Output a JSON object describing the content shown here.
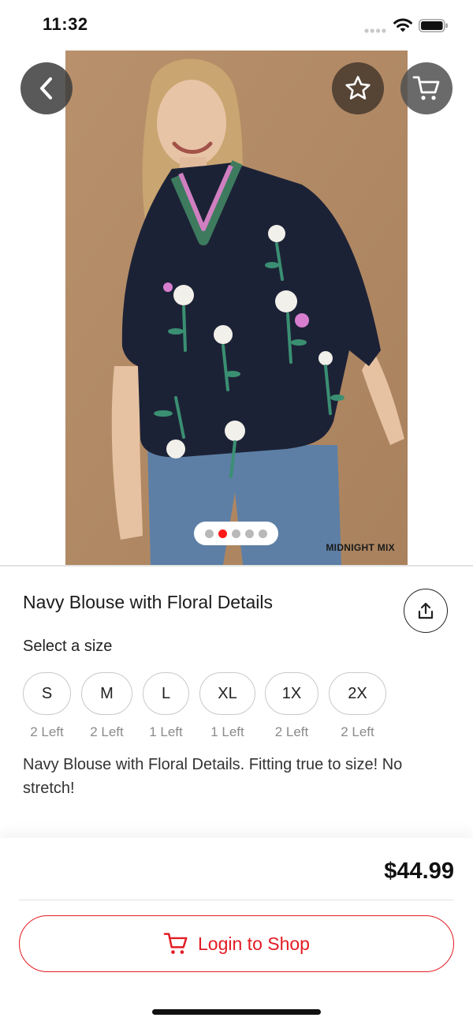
{
  "status_bar": {
    "time": "11:32"
  },
  "product": {
    "variant": "MIDNIGHT MIX",
    "title": "Navy Blouse with Floral Details",
    "size_prompt": "Select a size",
    "sizes": [
      {
        "label": "S",
        "stock": "2 Left"
      },
      {
        "label": "M",
        "stock": "2 Left"
      },
      {
        "label": "L",
        "stock": "1 Left"
      },
      {
        "label": "XL",
        "stock": "1 Left"
      },
      {
        "label": "1X",
        "stock": "2 Left"
      },
      {
        "label": "2X",
        "stock": "2 Left"
      }
    ],
    "description": "Navy Blouse with Floral Details. Fitting true to size! No stretch!",
    "price": "$44.99"
  },
  "gallery": {
    "page_count": 5,
    "active_index": 1
  },
  "actions": {
    "login_label": "Login to Shop"
  },
  "icons": {
    "back": "chevron-left-icon",
    "favorite": "star-outline-icon",
    "cart": "cart-icon",
    "share": "share-icon"
  },
  "colors": {
    "accent": "#e31b23",
    "active_dot": "#ff1a1a",
    "backdrop": "#b48d68",
    "blouse": "#1c2236"
  }
}
